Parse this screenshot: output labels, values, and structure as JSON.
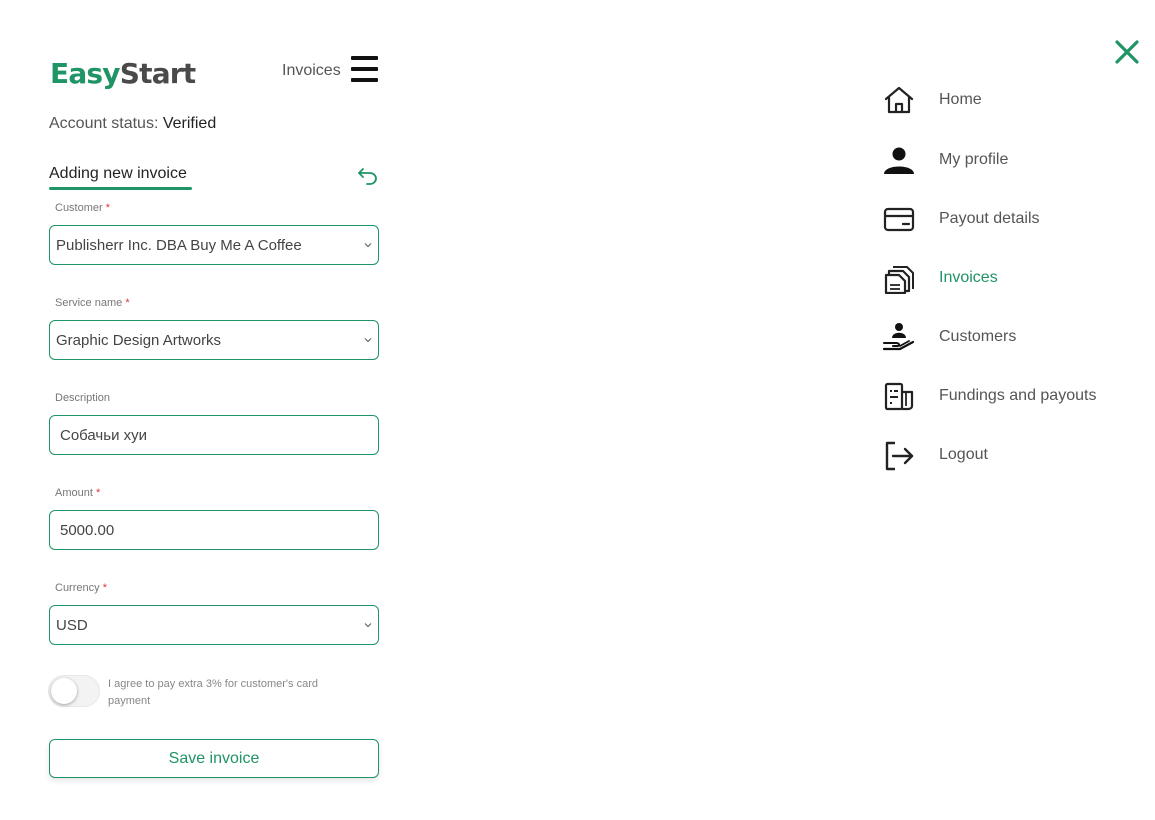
{
  "brand": {
    "part1": "Easy",
    "part2": "Start"
  },
  "header": {
    "page_label": "Invoices"
  },
  "account": {
    "status_label": "Account status:",
    "status_value": "Verified"
  },
  "form": {
    "title": "Adding new invoice",
    "customer": {
      "label": "Customer",
      "required_mark": "*",
      "value": "Publisherr Inc. DBA Buy Me A Coffee"
    },
    "service": {
      "label": "Service name",
      "required_mark": "*",
      "value": "Graphic Design Artworks"
    },
    "description": {
      "label": "Description",
      "value": "Собачьи хуи"
    },
    "amount": {
      "label": "Amount",
      "required_mark": "*",
      "value": "5000.00"
    },
    "currency": {
      "label": "Currency",
      "required_mark": "*",
      "value": "USD"
    },
    "agree_extra": {
      "label": "I agree to pay extra 3% for customer's card payment",
      "checked": false
    },
    "save_label": "Save invoice"
  },
  "menu": {
    "items": [
      {
        "label": "Home",
        "icon": "home-icon",
        "active": false
      },
      {
        "label": "My profile",
        "icon": "user-icon",
        "active": false
      },
      {
        "label": "Payout details",
        "icon": "card-icon",
        "active": false
      },
      {
        "label": "Invoices",
        "icon": "invoices-icon",
        "active": true
      },
      {
        "label": "Customers",
        "icon": "customers-icon",
        "active": false
      },
      {
        "label": "Fundings and payouts",
        "icon": "fundings-icon",
        "active": false
      },
      {
        "label": "Logout",
        "icon": "logout-icon",
        "active": false
      }
    ]
  },
  "colors": {
    "accent": "#1f9464",
    "required": "#e0343a",
    "text": "#555555"
  }
}
